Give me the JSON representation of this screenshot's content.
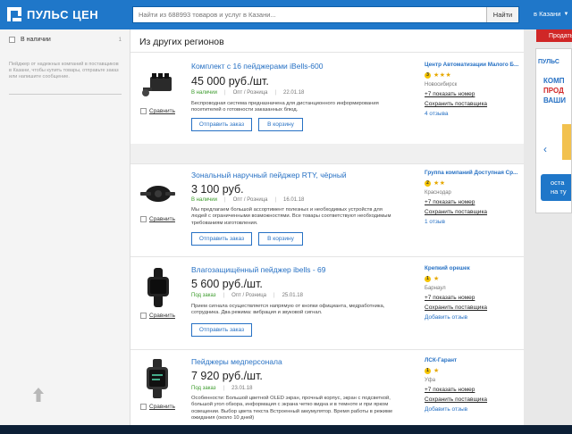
{
  "header": {
    "logo_text": "ПУЛЬС ЦЕН",
    "search_placeholder": "Найти из 688993 товаров и услуг в Казани...",
    "search_button": "Найти",
    "region": "в Казани"
  },
  "sidebar": {
    "filter_label": "В наличии",
    "filter_count": "1",
    "note": "Пейджер от надежных компаний в поставщиков в Казани, чтобы купить товары, отправьте заказ или напишите сообщение."
  },
  "main": {
    "section_title": "Из других регионов",
    "compare_label": "Сравнить",
    "send_order_label": "Отправить заказ",
    "cart_label": "В корзину",
    "show_phone_label": "+7 показать номер",
    "save_supplier_label": "Сохранить поставщика",
    "products": [
      {
        "title": "Комплект с 16 пейджерами iBells-600",
        "price": "45 000 руб./шт.",
        "availability": "В наличии",
        "sale_type": "Опт / Розница",
        "date": "22.01.18",
        "description": "Беспроводная система предназначена для дистанционного информирования посетителей о готовности заказанных блюд.",
        "seller": {
          "name": "Центр Автоматизации Малого Б...",
          "rating_badge": "3",
          "stars": "★★★",
          "city": "Новосибирск",
          "extra_link": "4 отзыва"
        }
      },
      {
        "title": "Зональный наручный пейджер RTY, чёрный",
        "price": "3 100 руб.",
        "availability": "В наличии",
        "sale_type": "Опт / Розница",
        "date": "16.01.18",
        "description": "Мы предлагаем большой ассортимент полезных и необходимых устройств для людей с ограниченными возможностями. Все товары соответствуют необходимым требованиям изготовления.",
        "seller": {
          "name": "Группа компаний Доступная Ср...",
          "rating_badge": "2",
          "stars": "★★",
          "city": "Краснодар",
          "extra_link": "1 отзыв"
        }
      },
      {
        "title": "Влагозащищённый пейджер ibells - 69",
        "price": "5 600 руб./шт.",
        "availability": "Под заказ",
        "sale_type": "Опт / Розница",
        "date": "25.01.18",
        "description": "Прием сигнала осуществляется напрямую от кнопки официанта, медработника, сотрудника. Два режима: вибрация и звуковой сигнал.",
        "seller": {
          "name": "Крепкий орешек",
          "rating_badge": "1",
          "stars": "★",
          "city": "Барнаул",
          "extra_link": "Добавить отзыв"
        }
      },
      {
        "title": "Пейджеры медперсонала",
        "price": "7 920 руб./шт.",
        "availability": "Под заказ",
        "sale_type": "",
        "date": "23.01.18",
        "description": "Особенности: Большой цветной OLED экран, прочный корпус, экран с подсветкой, большой угол обзора, информация с экрана четко видна и в темноте и при ярком освещении. Выбор цвета текста Встроенный аккумулятор. Время работы в режиме ожидания (около 10 дней)",
        "seller": {
          "name": "ЛСК-Гарант",
          "rating_badge": "1",
          "stars": "★",
          "city": "Уфа",
          "extra_link": "Добавить отзыв"
        }
      }
    ]
  },
  "right": {
    "red_tab": "Продать",
    "ad_logo": "ПУЛЬС",
    "ad_line1": "КОМП",
    "ad_line2": "ПРОД",
    "ad_line3": "ВАШИ",
    "ad_cta1": "оста",
    "ad_cta2": "на ту"
  }
}
